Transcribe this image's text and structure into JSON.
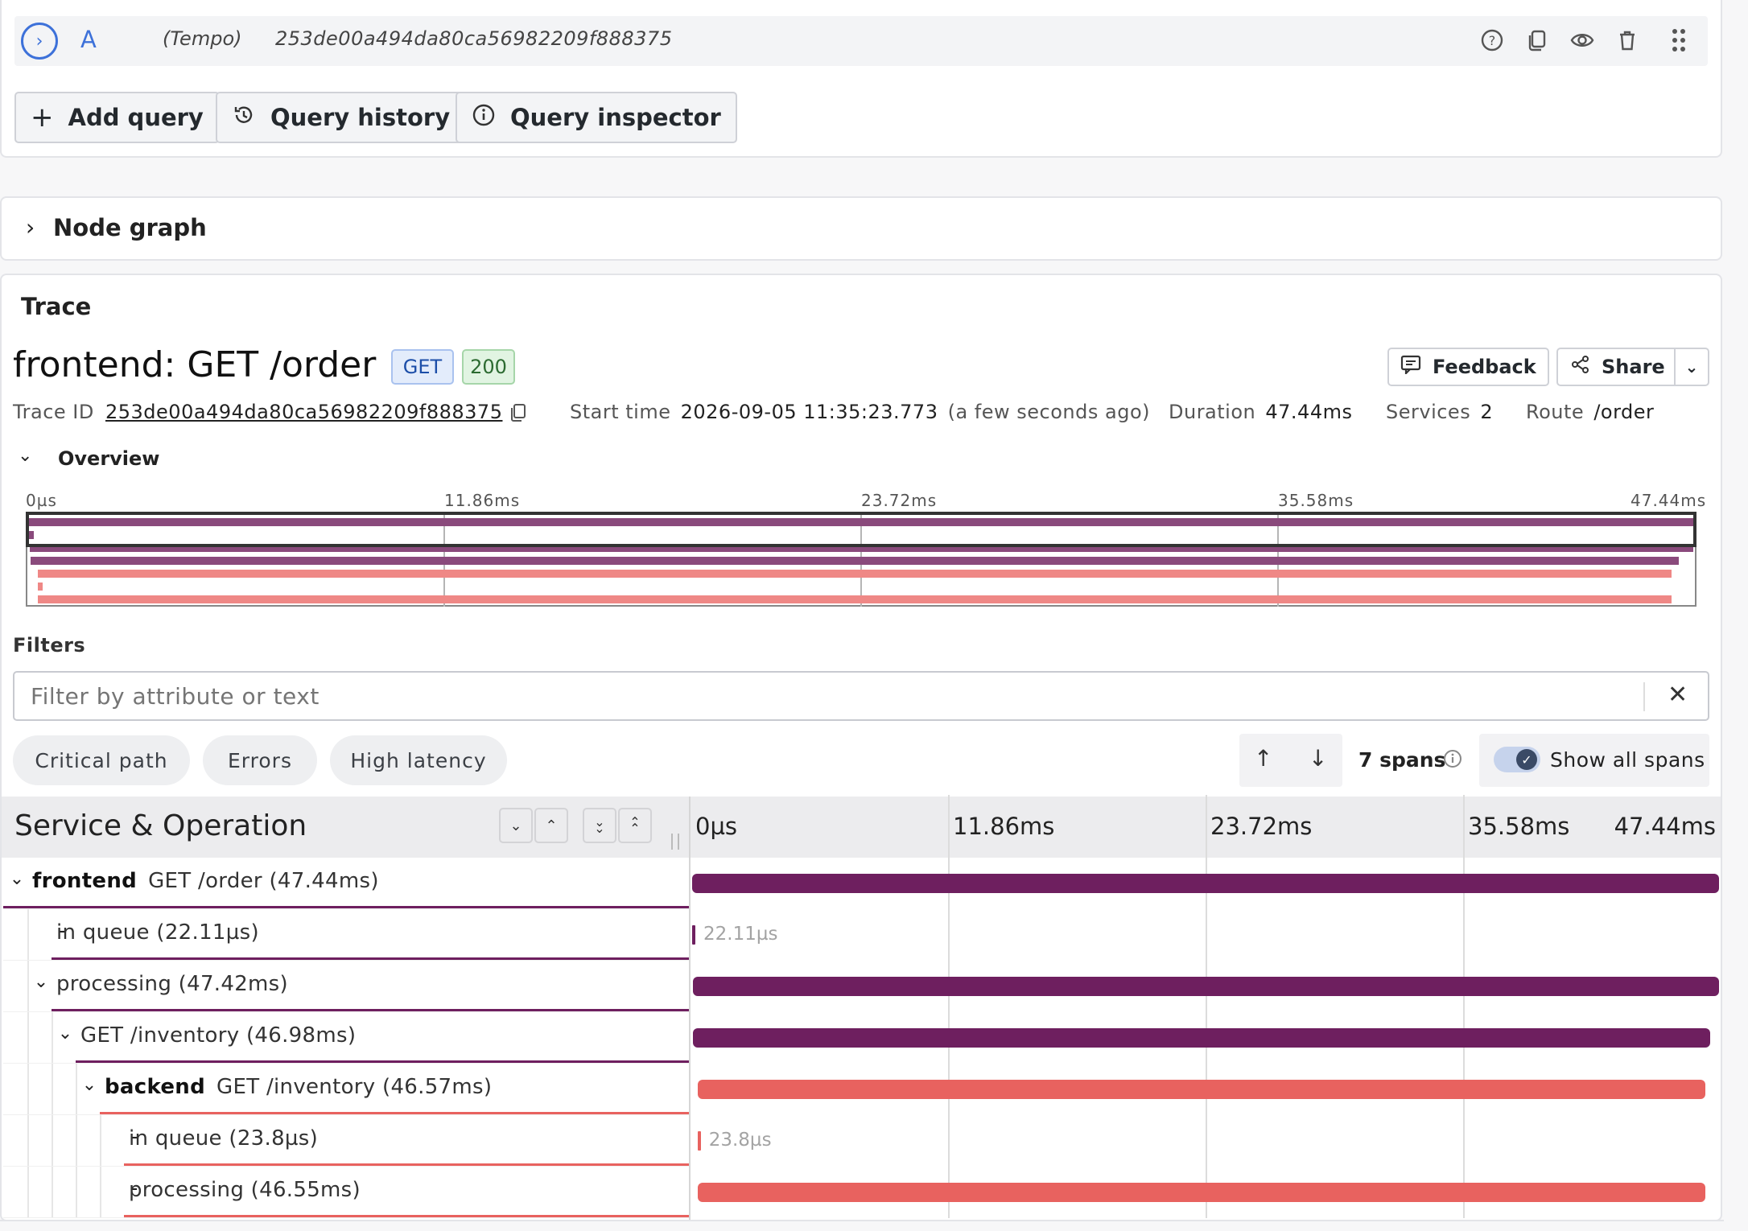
{
  "query_row": {
    "letter": "A",
    "datasource": "(Tempo)",
    "query_text": "253de00a494da80ca56982209f888375"
  },
  "query_actions": {
    "add_query": "Add query",
    "query_history": "Query history",
    "query_inspector": "Query inspector"
  },
  "node_graph": {
    "title": "Node graph"
  },
  "trace": {
    "panel_title": "Trace",
    "title": "frontend: GET /order",
    "method_badge": "GET",
    "status_badge": "200",
    "feedback_label": "Feedback",
    "share_label": "Share",
    "trace_id_label": "Trace ID",
    "trace_id": "253de00a494da80ca56982209f888375",
    "start_time_label": "Start time",
    "start_time": "2026-09-05 11:35:23.773",
    "start_time_relative": "(a few seconds ago)",
    "duration_label": "Duration",
    "duration": "47.44ms",
    "services_label": "Services",
    "services": "2",
    "route_label": "Route",
    "route": "/order",
    "overview_label": "Overview",
    "ticks": [
      "0µs",
      "11.86ms",
      "23.72ms",
      "35.58ms",
      "47.44ms"
    ]
  },
  "filters": {
    "label": "Filters",
    "placeholder": "Filter by attribute or text",
    "critical_path": "Critical path",
    "errors": "Errors",
    "high_latency": "High latency",
    "spans_count": "7 spans",
    "show_all_spans": "Show all spans",
    "show_all_spans_checked": true
  },
  "table": {
    "header": "Service & Operation",
    "spans": [
      {
        "service": "frontend",
        "operation": "GET /order (47.44ms)",
        "depth": 0,
        "toggle": "expand",
        "color": "#6e1f5f",
        "start_ms": 0,
        "duration_ms": 47.44,
        "label": ""
      },
      {
        "service": "",
        "operation": "in queue (22.11µs)",
        "depth": 1,
        "toggle": "leaf",
        "color": "#6e1f5f",
        "start_ms": 0,
        "duration_ms": 0.02211,
        "label": "22.11µs"
      },
      {
        "service": "",
        "operation": "processing (47.42ms)",
        "depth": 1,
        "toggle": "expand",
        "color": "#6e1f5f",
        "start_ms": 0.02,
        "duration_ms": 47.42,
        "label": ""
      },
      {
        "service": "",
        "operation": "GET /inventory (46.98ms)",
        "depth": 2,
        "toggle": "expand",
        "color": "#6e1f5f",
        "start_ms": 0.05,
        "duration_ms": 46.98,
        "label": ""
      },
      {
        "service": "backend",
        "operation": "GET /inventory (46.57ms)",
        "depth": 3,
        "toggle": "expand",
        "color": "#e8625f",
        "start_ms": 0.25,
        "duration_ms": 46.57,
        "label": ""
      },
      {
        "service": "",
        "operation": "in queue (23.8µs)",
        "depth": 4,
        "toggle": "leaf",
        "color": "#e8625f",
        "start_ms": 0.25,
        "duration_ms": 0.0238,
        "label": "23.8µs"
      },
      {
        "service": "",
        "operation": "processing (46.55ms)",
        "depth": 4,
        "toggle": "leaf",
        "color": "#e8625f",
        "start_ms": 0.26,
        "duration_ms": 46.55,
        "label": ""
      }
    ]
  },
  "colors": {
    "frontend": "#6e1f5f",
    "backend": "#e8625f",
    "accent": "#3d71d9"
  }
}
